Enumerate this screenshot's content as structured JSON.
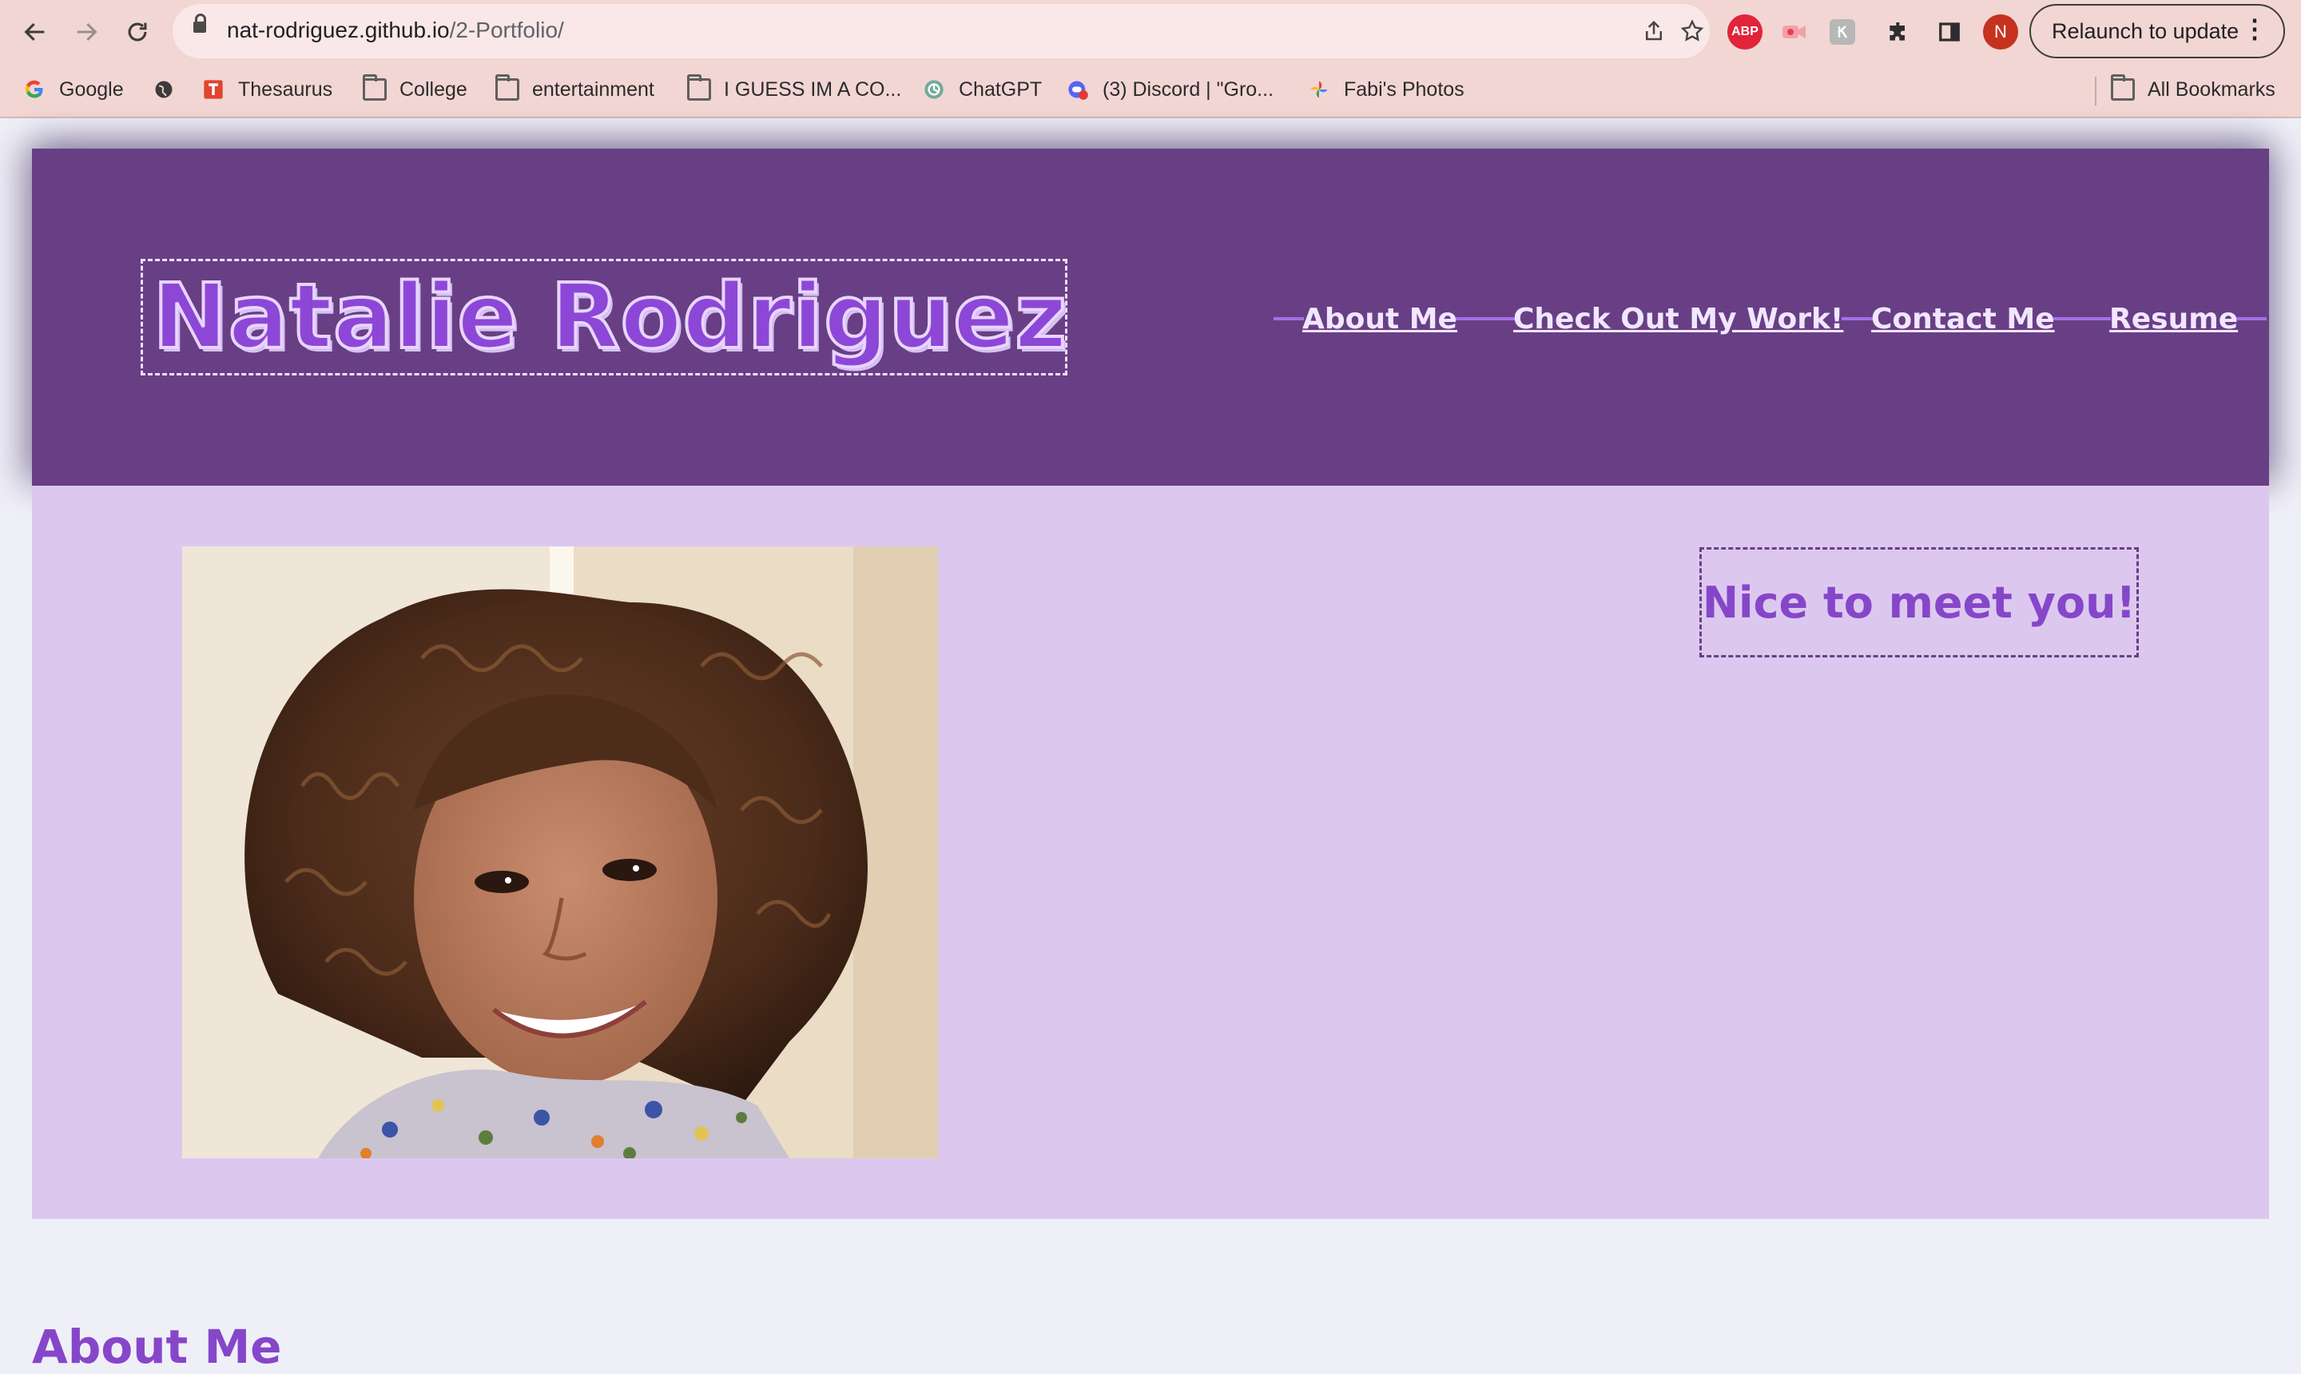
{
  "browser": {
    "url_domain": "nat-rodriguez.github.io",
    "url_path": "/2-Portfolio/",
    "relaunch_label": "Relaunch to update",
    "profile_initial": "N",
    "ext_abp_label": "ABP",
    "bookmarks": [
      {
        "label": "Google",
        "icon": "google-icon"
      },
      {
        "label": "",
        "icon": "globe-icon"
      },
      {
        "label": "Thesaurus",
        "icon": "thesaurus-icon"
      },
      {
        "label": "College",
        "icon": "folder-icon"
      },
      {
        "label": "entertainment",
        "icon": "folder-icon"
      },
      {
        "label": "I GUESS IM A CO...",
        "icon": "folder-icon"
      },
      {
        "label": "ChatGPT",
        "icon": "chatgpt-icon"
      },
      {
        "label": "(3) Discord | \"Gro...",
        "icon": "discord-icon"
      },
      {
        "label": "Fabi's Photos",
        "icon": "photos-icon"
      }
    ],
    "all_bookmarks_label": "All Bookmarks"
  },
  "site": {
    "logo_text": "Natalie Rodriguez",
    "nav": [
      "About Me",
      "Check Out My Work!",
      "Contact Me",
      "Resume"
    ],
    "greeting": "Nice to meet you!",
    "about_heading": "About Me"
  },
  "colors": {
    "header_bg": "#683f85",
    "hero_bg": "#dcc8ef",
    "accent": "#8646c9",
    "page_bg": "#efeff8",
    "chrome_bg": "#f2d6d3"
  }
}
